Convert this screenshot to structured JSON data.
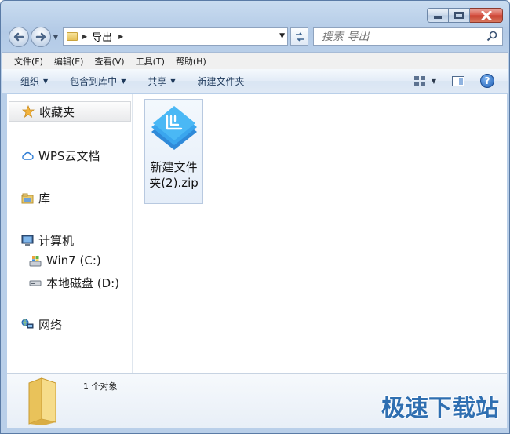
{
  "window": {
    "caption_buttons": [
      "minimize",
      "maximize",
      "close"
    ]
  },
  "address": {
    "crumbs": [
      "导出"
    ],
    "search_placeholder": "搜索 导出"
  },
  "menubar": {
    "items": [
      "文件(F)",
      "编辑(E)",
      "查看(V)",
      "工具(T)",
      "帮助(H)"
    ]
  },
  "commandbar": {
    "organize": "组织",
    "include_library": "包含到库中",
    "share": "共享",
    "new_folder": "新建文件夹"
  },
  "navpane": {
    "favorites": "收藏夹",
    "wps_cloud": "WPS云文档",
    "libraries": "库",
    "computer": "计算机",
    "drive_c": "Win7 (C:)",
    "drive_d": "本地磁盘 (D:)",
    "network": "网络"
  },
  "content": {
    "files": [
      {
        "name": "新建文件夹(2).zip",
        "icon": "wps-zip-icon"
      }
    ]
  },
  "details": {
    "count_text": "1 个对象"
  },
  "watermark": "极速下载站",
  "colors": {
    "accent": "#2f6fb1",
    "zip_icon": "#3aa6ee"
  }
}
